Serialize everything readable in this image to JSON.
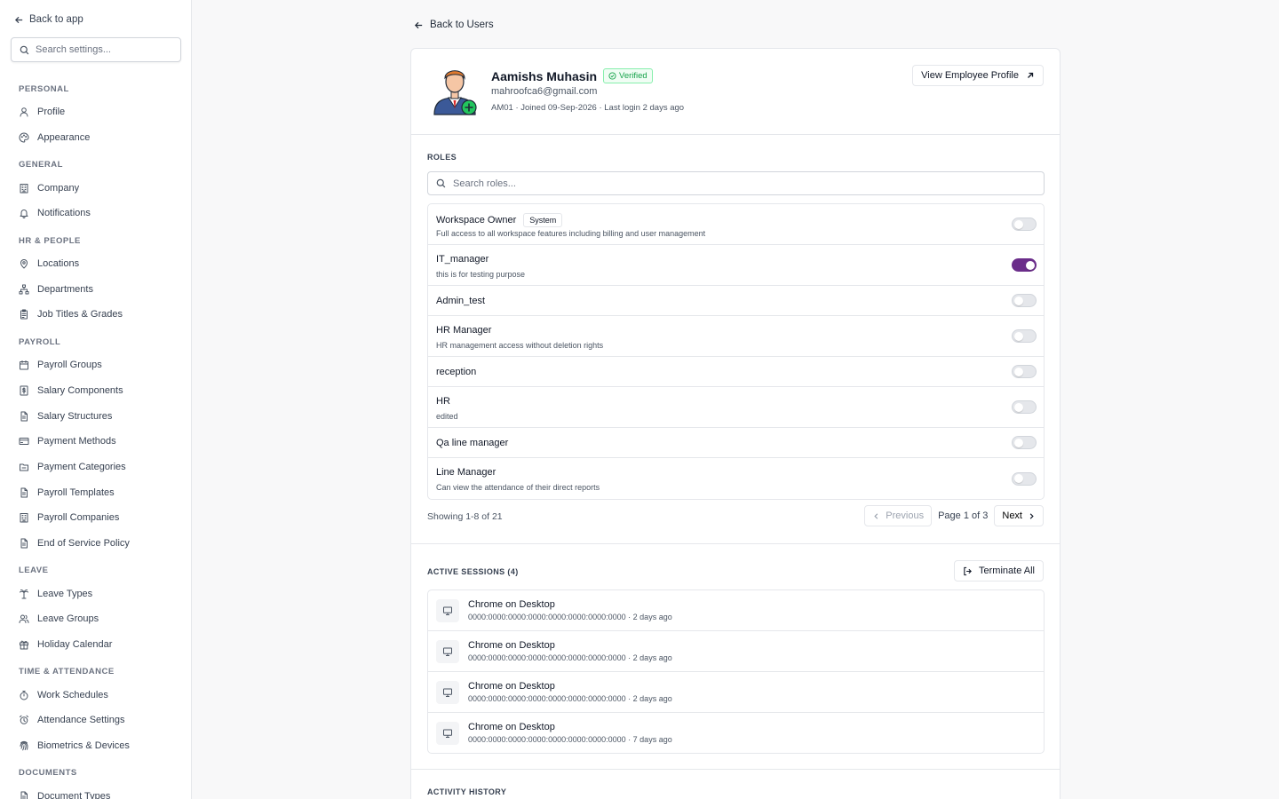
{
  "sidebar": {
    "back_label": "Back to app",
    "search_placeholder": "Search settings...",
    "sections": [
      {
        "title": "PERSONAL",
        "items": [
          {
            "label": "Profile",
            "icon": "user-icon"
          },
          {
            "label": "Appearance",
            "icon": "palette-icon"
          }
        ]
      },
      {
        "title": "GENERAL",
        "items": [
          {
            "label": "Company",
            "icon": "building-icon"
          },
          {
            "label": "Notifications",
            "icon": "bell-icon"
          }
        ]
      },
      {
        "title": "HR & PEOPLE",
        "items": [
          {
            "label": "Locations",
            "icon": "map-pin-icon"
          },
          {
            "label": "Departments",
            "icon": "org-chart-icon"
          },
          {
            "label": "Job Titles & Grades",
            "icon": "clipboard-icon"
          }
        ]
      },
      {
        "title": "PAYROLL",
        "items": [
          {
            "label": "Payroll Groups",
            "icon": "calendar-icon"
          },
          {
            "label": "Salary Components",
            "icon": "dollar-file-icon"
          },
          {
            "label": "Salary Structures",
            "icon": "file-text-icon"
          },
          {
            "label": "Payment Methods",
            "icon": "credit-card-icon"
          },
          {
            "label": "Payment Categories",
            "icon": "folder-icon"
          },
          {
            "label": "Payroll Templates",
            "icon": "file-text-icon"
          },
          {
            "label": "Payroll Companies",
            "icon": "building-icon"
          },
          {
            "label": "End of Service Policy",
            "icon": "file-text-icon"
          }
        ]
      },
      {
        "title": "LEAVE",
        "items": [
          {
            "label": "Leave Types",
            "icon": "palm-tree-icon"
          },
          {
            "label": "Leave Groups",
            "icon": "users-icon"
          },
          {
            "label": "Holiday Calendar",
            "icon": "gift-icon"
          }
        ]
      },
      {
        "title": "TIME & ATTENDANCE",
        "items": [
          {
            "label": "Work Schedules",
            "icon": "timer-icon"
          },
          {
            "label": "Attendance Settings",
            "icon": "alarm-clock-icon"
          },
          {
            "label": "Biometrics & Devices",
            "icon": "fingerprint-icon"
          }
        ]
      },
      {
        "title": "DOCUMENTS",
        "items": [
          {
            "label": "Document Types",
            "icon": "file-text-icon"
          }
        ]
      }
    ]
  },
  "main": {
    "back_label": "Back to Users",
    "user": {
      "name": "Aamishs Muhasin",
      "verified_label": "Verified",
      "email": "mahroofca6@gmail.com",
      "meta": "AM01 · Joined 09-Sep-2026 · Last login 2 days ago",
      "view_profile_label": "View Employee Profile"
    },
    "roles": {
      "label": "ROLES",
      "search_placeholder": "Search roles...",
      "items": [
        {
          "name": "Workspace Owner",
          "badge": "System",
          "description": "Full access to all workspace features including billing and user management",
          "enabled": false
        },
        {
          "name": "IT_manager",
          "badge": "",
          "description": "this is for testing purpose",
          "enabled": true
        },
        {
          "name": "Admin_test",
          "badge": "",
          "description": "",
          "enabled": false
        },
        {
          "name": "HR Manager",
          "badge": "",
          "description": "HR management access without deletion rights",
          "enabled": false
        },
        {
          "name": "reception",
          "badge": "",
          "description": "",
          "enabled": false
        },
        {
          "name": "HR",
          "badge": "",
          "description": "edited",
          "enabled": false
        },
        {
          "name": "Qa line manager",
          "badge": "",
          "description": "",
          "enabled": false
        },
        {
          "name": "Line Manager",
          "badge": "",
          "description": "Can view the attendance of their direct reports",
          "enabled": false
        }
      ],
      "showing_text": "Showing 1-8 of 21",
      "previous_label": "Previous",
      "page_info": "Page 1 of 3",
      "next_label": "Next"
    },
    "sessions": {
      "label": "ACTIVE SESSIONS (4)",
      "terminate_label": "Terminate All",
      "items": [
        {
          "title": "Chrome on Desktop",
          "detail": "0000:0000:0000:0000:0000:0000:0000:0000 · 2 days ago"
        },
        {
          "title": "Chrome on Desktop",
          "detail": "0000:0000:0000:0000:0000:0000:0000:0000 · 2 days ago"
        },
        {
          "title": "Chrome on Desktop",
          "detail": "0000:0000:0000:0000:0000:0000:0000:0000 · 2 days ago"
        },
        {
          "title": "Chrome on Desktop",
          "detail": "0000:0000:0000:0000:0000:0000:0000:0000 · 7 days ago"
        }
      ]
    },
    "activity_label": "ACTIVITY HISTORY"
  },
  "colors": {
    "accent": "#6b2d8a",
    "verified": "#16a34a",
    "border": "#e5e7eb"
  }
}
